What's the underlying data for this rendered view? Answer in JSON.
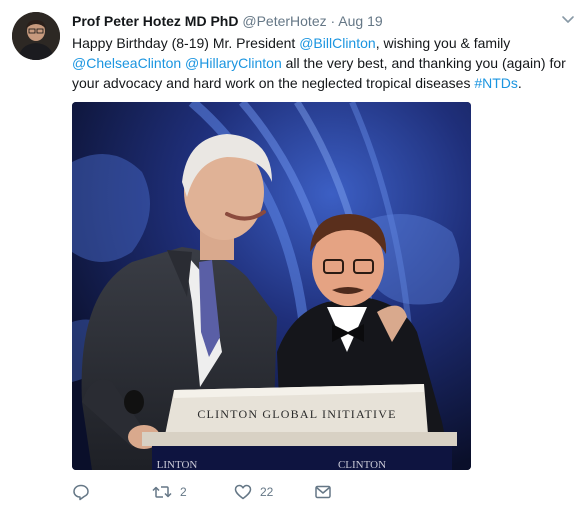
{
  "tweet": {
    "display_name": "Prof Peter Hotez MD PhD",
    "handle": "@PeterHotez",
    "separator": "·",
    "date": "Aug 19",
    "text": {
      "part1": "Happy Birthday (8-19) Mr. President ",
      "mention1": "@BillClinton",
      "part2": ", wishing you & family",
      "mention2": "@ChelseaClinton",
      "part3": " ",
      "mention3": "@HillaryClinton",
      "part4": " all the very best, and thanking you (again) for your advocacy and hard work on the neglected tropical diseases ",
      "hashtag": "#NTDs",
      "part5": "."
    },
    "photo": {
      "podium_text": "CLINTON GLOBAL INITIATIVE",
      "banner_left": "LINTON",
      "banner_right": "CLINTON"
    },
    "actions": {
      "reply_count": "",
      "retweet_count": "2",
      "like_count": "22"
    }
  },
  "colors": {
    "link": "#1b95e0",
    "muted": "#657786",
    "text": "#14171a"
  },
  "icons": [
    "reply-icon",
    "retweet-icon",
    "heart-icon",
    "message-icon",
    "chevron-down-icon"
  ]
}
